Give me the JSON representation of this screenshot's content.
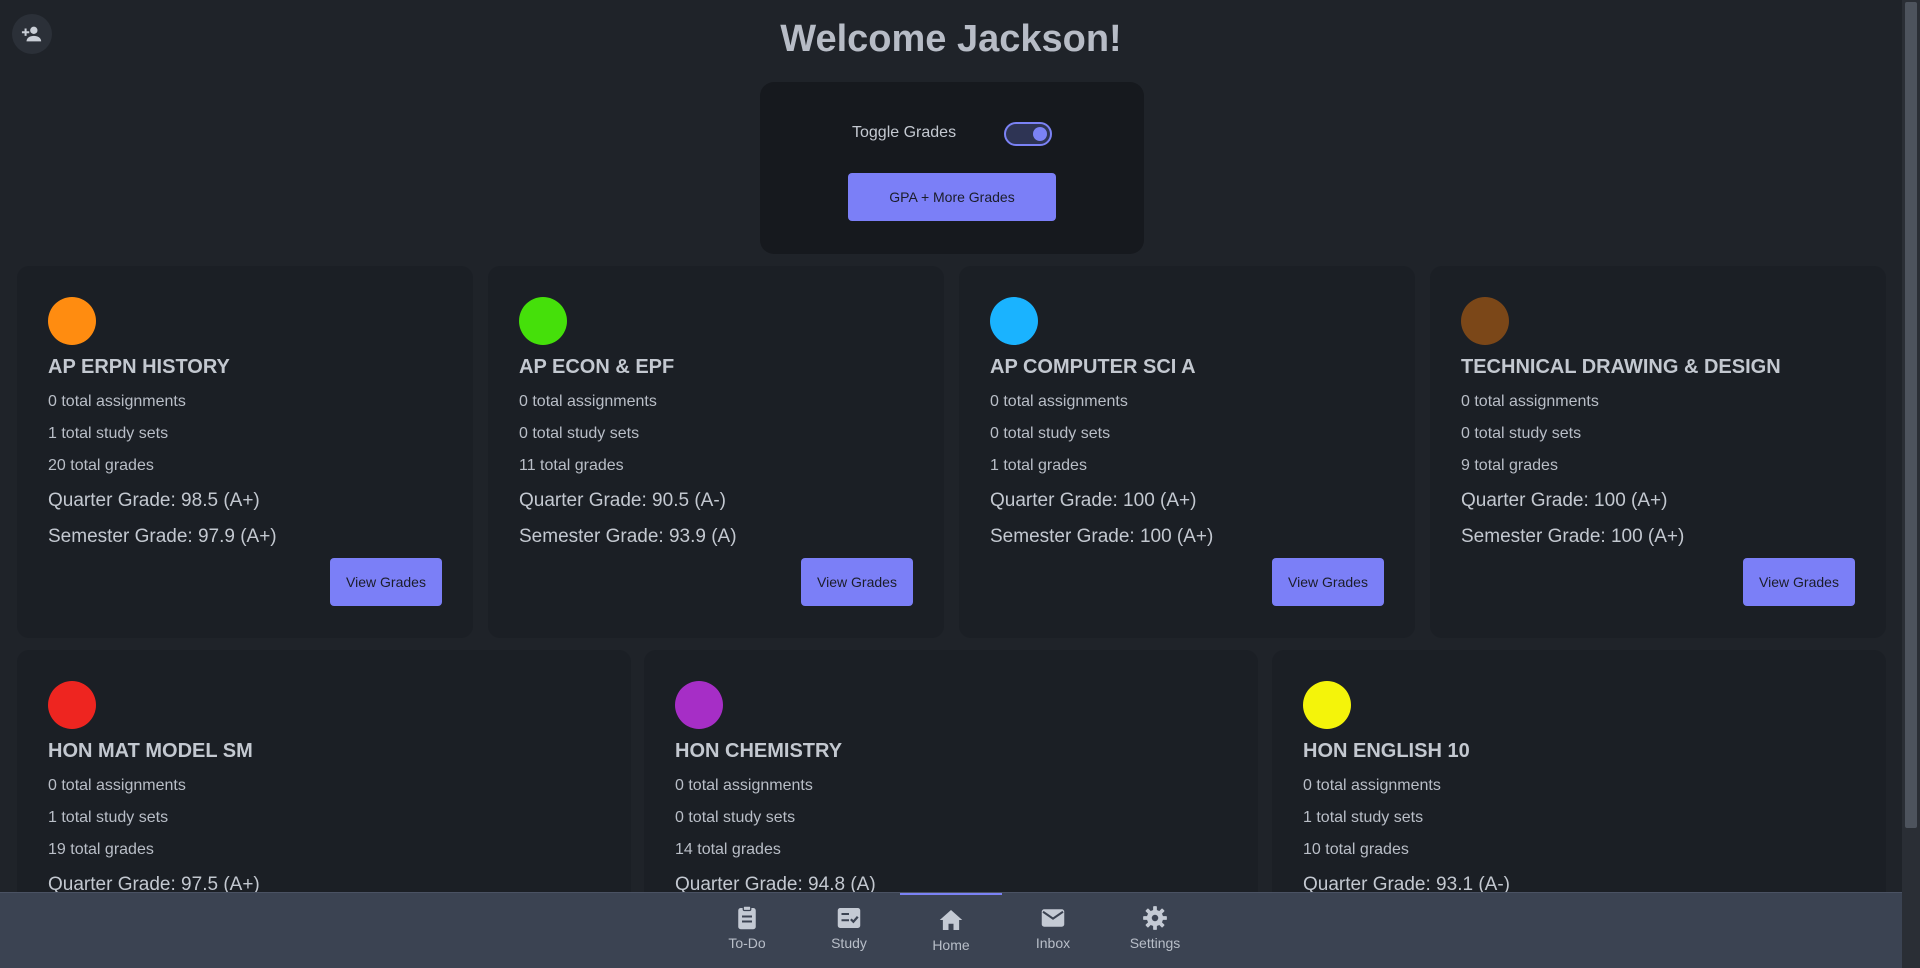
{
  "header": {
    "title": "Welcome Jackson!"
  },
  "grades_panel": {
    "toggle_label": "Toggle Grades",
    "toggle_on": true,
    "gpa_button": "GPA + More Grades"
  },
  "courses": [
    {
      "name": "AP ERPN HISTORY",
      "color": "#ff8c10",
      "assignments": "0 total assignments",
      "study_sets": "1 total study sets",
      "grades": "20 total grades",
      "quarter": "Quarter Grade: 98.5 (A+)",
      "semester": "Semester Grade: 97.9 (A+)",
      "button": "View Grades"
    },
    {
      "name": "AP ECON & EPF",
      "color": "#45e00a",
      "assignments": "0 total assignments",
      "study_sets": "0 total study sets",
      "grades": "11 total grades",
      "quarter": "Quarter Grade: 90.5 (A-)",
      "semester": "Semester Grade: 93.9 (A)",
      "button": "View Grades"
    },
    {
      "name": "AP COMPUTER SCI A",
      "color": "#1ab3ff",
      "assignments": "0 total assignments",
      "study_sets": "0 total study sets",
      "grades": "1 total grades",
      "quarter": "Quarter Grade: 100 (A+)",
      "semester": "Semester Grade: 100 (A+)",
      "button": "View Grades"
    },
    {
      "name": "TECHNICAL DRAWING & DESIGN",
      "color": "#7b4718",
      "assignments": "0 total assignments",
      "study_sets": "0 total study sets",
      "grades": "9 total grades",
      "quarter": "Quarter Grade: 100 (A+)",
      "semester": "Semester Grade: 100 (A+)",
      "button": "View Grades"
    },
    {
      "name": "HON MAT MODEL SM",
      "color": "#ee2520",
      "assignments": "0 total assignments",
      "study_sets": "1 total study sets",
      "grades": "19 total grades",
      "quarter": "Quarter Grade: 97.5 (A+)"
    },
    {
      "name": "HON CHEMISTRY",
      "color": "#a62ec6",
      "assignments": "0 total assignments",
      "study_sets": "0 total study sets",
      "grades": "14 total grades",
      "quarter": "Quarter Grade: 94.8 (A)"
    },
    {
      "name": "HON ENGLISH 10",
      "color": "#f4f40a",
      "assignments": "0 total assignments",
      "study_sets": "1 total study sets",
      "grades": "10 total grades",
      "quarter": "Quarter Grade: 93.1 (A-)"
    }
  ],
  "nav": {
    "items": [
      {
        "label": "To-Do",
        "icon": "clipboard-icon"
      },
      {
        "label": "Study",
        "icon": "checklist-icon"
      },
      {
        "label": "Home",
        "icon": "home-icon",
        "active": true
      },
      {
        "label": "Inbox",
        "icon": "mail-icon"
      },
      {
        "label": "Settings",
        "icon": "gear-icon"
      }
    ]
  },
  "colors": {
    "accent": "#7b7ff7",
    "background": "#1f2329",
    "card": "#1b1f25",
    "nav": "#3b4352"
  }
}
